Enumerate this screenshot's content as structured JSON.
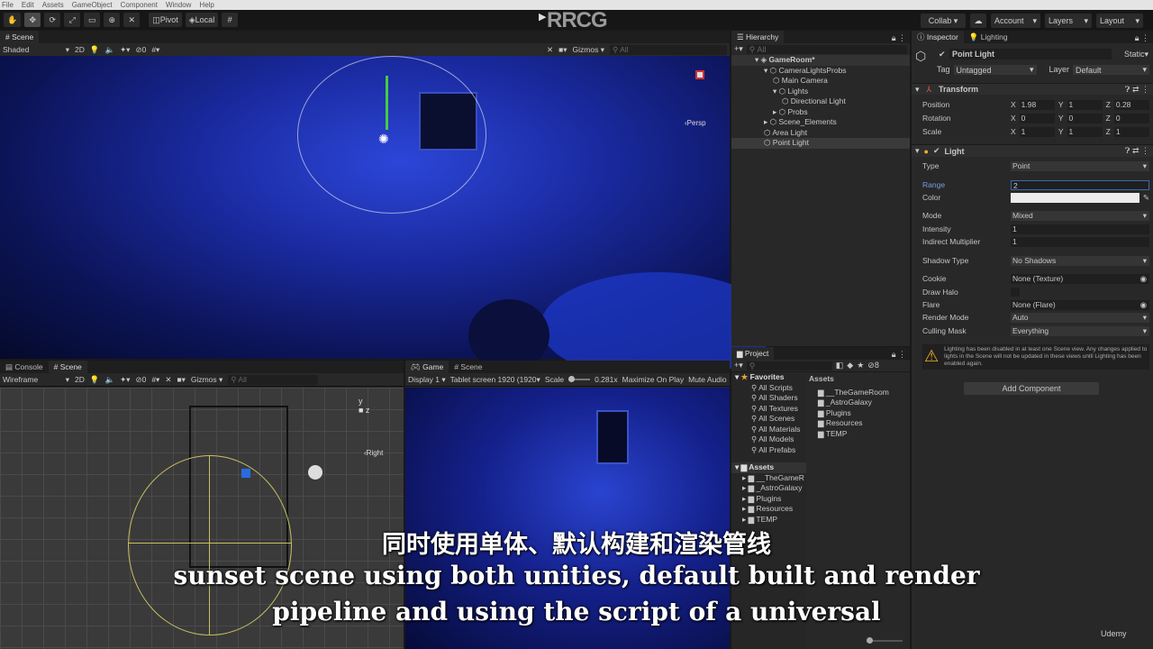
{
  "menu": [
    "File",
    "Edit",
    "Assets",
    "GameObject",
    "Component",
    "Window",
    "Help"
  ],
  "toolbar": {
    "pivot": "Pivot",
    "local": "Local",
    "collab": "Collab",
    "account": "Account",
    "layers": "Layers",
    "layout": "Layout",
    "watermark": "RRCG"
  },
  "scene_top": {
    "tab": "Scene",
    "shading": "Shaded",
    "mode_2d": "2D",
    "hidden_count": "0",
    "gizmos": "Gizmos",
    "search_placeholder": "All",
    "persp": "‹Persp"
  },
  "hierarchy": {
    "title": "Hierarchy",
    "search_placeholder": "All",
    "items": [
      {
        "label": "GameRoom*",
        "depth": 0,
        "expanded": true
      },
      {
        "label": "CameraLightsProbs",
        "depth": 1,
        "expanded": true
      },
      {
        "label": "Main Camera",
        "depth": 2
      },
      {
        "label": "Lights",
        "depth": 2,
        "expanded": true
      },
      {
        "label": "Directional Light",
        "depth": 3
      },
      {
        "label": "Probs",
        "depth": 2,
        "collapsed": true
      },
      {
        "label": "Scene_Elements",
        "depth": 1,
        "collapsed": true
      },
      {
        "label": "Area Light",
        "depth": 1
      },
      {
        "label": "Point Light",
        "depth": 1,
        "selected": true
      }
    ]
  },
  "inspector": {
    "tab": "Inspector",
    "tab2": "Lighting",
    "object_name": "Point Light",
    "static": "Static",
    "tag_label": "Tag",
    "tag": "Untagged",
    "layer_label": "Layer",
    "layer": "Default",
    "transform": {
      "title": "Transform",
      "position": {
        "label": "Position",
        "x": "1.98",
        "y": "1",
        "z": "0.28"
      },
      "rotation": {
        "label": "Rotation",
        "x": "0",
        "y": "0",
        "z": "0"
      },
      "scale": {
        "label": "Scale",
        "x": "1",
        "y": "1",
        "z": "1"
      }
    },
    "light": {
      "title": "Light",
      "type_label": "Type",
      "type": "Point",
      "range_label": "Range",
      "range": "2",
      "color_label": "Color",
      "color": "#ececec",
      "mode_label": "Mode",
      "mode": "Mixed",
      "intensity_label": "Intensity",
      "intensity": "1",
      "indirect_label": "Indirect Multiplier",
      "indirect": "1",
      "shadow_label": "Shadow Type",
      "shadow": "No Shadows",
      "cookie_label": "Cookie",
      "cookie": "None (Texture)",
      "halo_label": "Draw Halo",
      "flare_label": "Flare",
      "flare": "None (Flare)",
      "render_label": "Render Mode",
      "render": "Auto",
      "culling_label": "Culling Mask",
      "culling": "Everything"
    },
    "warning": "Lighting has been disabled in at least one Scene view. Any changes applied to lights in the Scene will not be updated in these views until Lighting has been enabled again.",
    "add_component": "Add Component"
  },
  "project": {
    "title": "Project",
    "hidden_count": "8",
    "favorites": "Favorites",
    "fav_items": [
      "All Scripts",
      "All Shaders",
      "All Textures",
      "All Scenes",
      "All Materials",
      "All Models",
      "All Prefabs"
    ],
    "assets_label": "Assets",
    "tree": [
      "__TheGameR",
      "_AstroGalaxy",
      "Plugins",
      "Resources",
      "TEMP"
    ],
    "assets_header": "Assets",
    "folders": [
      "__TheGameRoom",
      "_AstroGalaxy",
      "Plugins",
      "Resources",
      "TEMP"
    ]
  },
  "scene_bottom": {
    "tab1": "Console",
    "tab2": "Scene",
    "shading": "Wireframe",
    "mode_2d": "2D",
    "hidden_count": "0",
    "gizmos": "Gizmos",
    "search_placeholder": "All",
    "view": "‹Right"
  },
  "game": {
    "tab1": "Game",
    "tab2": "Scene",
    "display": "Display 1",
    "resolution": "Tablet screen 1920 (1920",
    "scale_label": "Scale",
    "scale": "0.281x",
    "maximize": "Maximize On Play",
    "mute": "Mute Audio"
  },
  "subtitles": {
    "zh": "同时使用单体、默认构建和渲染管线",
    "en1": "sunset scene using both unities, default built and render",
    "en2": "pipeline and using the script of a universal"
  },
  "brand": "Udemy"
}
